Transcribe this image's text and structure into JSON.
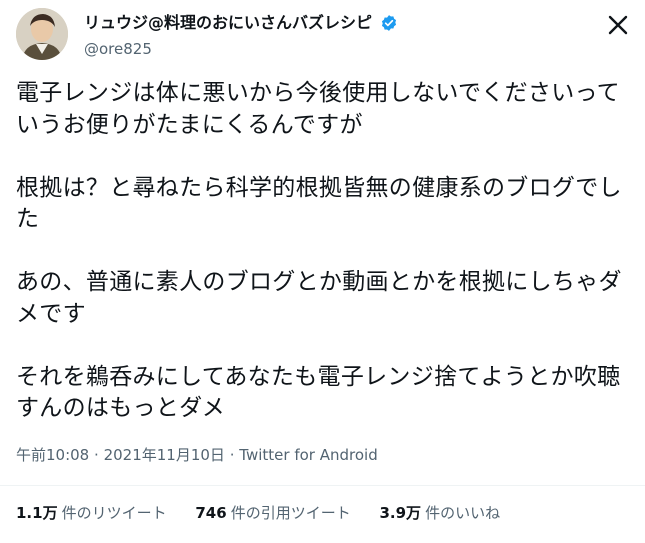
{
  "header": {
    "display_name": "リュウジ@料理のおにいさんバズレシピ",
    "handle": "@ore825"
  },
  "tweet": {
    "paragraphs": [
      "電子レンジは体に悪いから今後使用しないでくださいっていうお便りがたまにくるんですが",
      "根拠は？と尋ねたら科学的根拠皆無の健康系のブログでした",
      "あの、普通に素人のブログとか動画とかを根拠にしちゃダメです",
      "それを鵜呑みにしてあなたも電子レンジ捨てようとか吹聴すんのはもっとダメ"
    ],
    "time": "午前10:08",
    "date": "2021年11月10日",
    "separator": "·",
    "source": "Twitter for Android"
  },
  "stats": {
    "retweets": {
      "value": "1.1万",
      "label": "件のリツイート"
    },
    "quotes": {
      "value": "746",
      "label": "件の引用ツイート"
    },
    "likes": {
      "value": "3.9万",
      "label": "件のいいね"
    }
  },
  "colors": {
    "verified": "#1d9bf0",
    "text": "#0f1419",
    "secondary": "#536471"
  },
  "icons": {
    "verified": "verified-badge-icon",
    "close": "x-logo-icon"
  }
}
